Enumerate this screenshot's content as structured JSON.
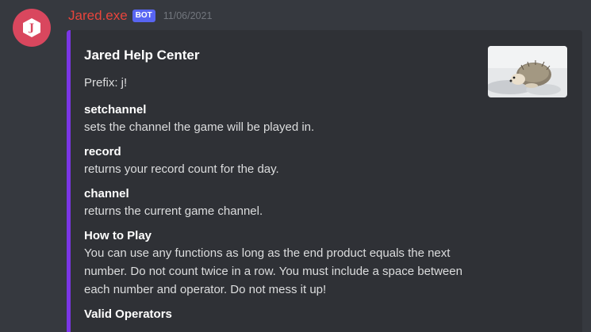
{
  "message": {
    "author": "Jared.exe",
    "bot_tag": "BOT",
    "timestamp": "11/06/2021",
    "avatar_letter": "J",
    "avatar_color": "#d9475e",
    "username_color": "#e8453c"
  },
  "embed": {
    "accent_color": "#7b36e6",
    "title": "Jared Help Center",
    "description": "Prefix: j!",
    "thumbnail": "hedgehog-photo",
    "fields": [
      {
        "name": "setchannel",
        "value": "sets the channel the game will be played in."
      },
      {
        "name": "record",
        "value": "returns your record count for the day."
      },
      {
        "name": "channel",
        "value": "returns the current game channel."
      },
      {
        "name": "How to Play",
        "value": "You can use any functions as long as the end product equals the next number. Do not count twice in a row. You must include a space between each number and operator. Do not mess it up!"
      },
      {
        "name": "Valid Operators",
        "value": ""
      }
    ]
  }
}
